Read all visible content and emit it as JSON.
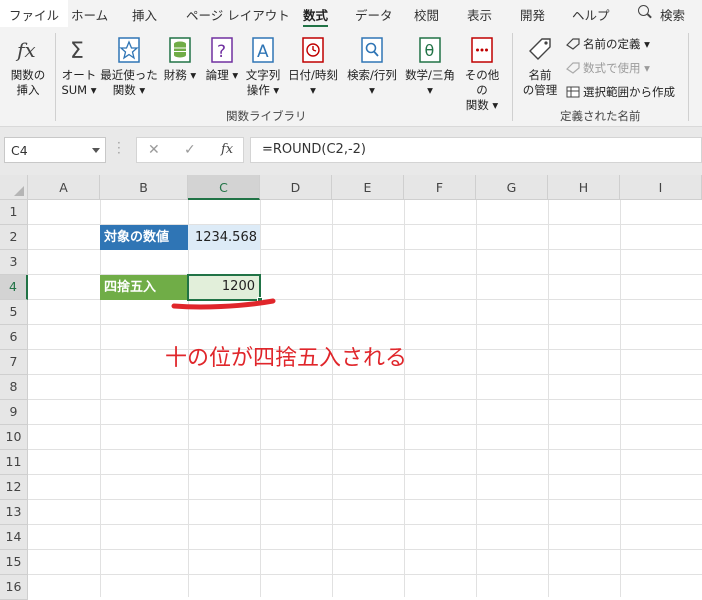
{
  "ribbon_tabs": [
    "ファイル",
    "ホーム",
    "挿入",
    "ページ レイアウト",
    "数式",
    "データ",
    "校閲",
    "表示",
    "開発",
    "ヘルプ"
  ],
  "search_label": "検索",
  "ribbon": {
    "insert_function": [
      "関数の",
      "挿入"
    ],
    "autosum": [
      "オート",
      "SUM"
    ],
    "recent": [
      "最近使った",
      "関数"
    ],
    "financial": "財務",
    "logical": "論理",
    "text": [
      "文字列",
      "操作"
    ],
    "datetime": "日付/時刻",
    "lookup": "検索/行列",
    "math": "数学/三角",
    "more": [
      "その他の",
      "関数"
    ],
    "group_library": "関数ライブラリ",
    "name_manager": [
      "名前",
      "の管理"
    ],
    "define_name": "名前の定義",
    "use_in_formula": "数式で使用",
    "create_from_selection": "選択範囲から作成",
    "group_names": "定義された名前"
  },
  "formula_bar": {
    "name_box": "C4",
    "cancel": "✕",
    "enter": "✓",
    "fx": "fx",
    "formula": "=ROUND(C2,-2)"
  },
  "columns": [
    "A",
    "B",
    "C",
    "D",
    "E",
    "F",
    "G",
    "H",
    "I"
  ],
  "rows": [
    "1",
    "2",
    "3",
    "4",
    "5",
    "6",
    "7",
    "8",
    "9",
    "10",
    "11",
    "12",
    "13",
    "14",
    "15",
    "16"
  ],
  "cells": {
    "B2": "対象の数値",
    "C2": "1234.568",
    "B4": "四捨五入",
    "C4": "1200"
  },
  "annotation": "十の位が四捨五入される",
  "colors": {
    "accent": "#217346",
    "label_blue": "#2f75b5",
    "label_green": "#70ad47",
    "annotation_red": "#e0262b"
  }
}
